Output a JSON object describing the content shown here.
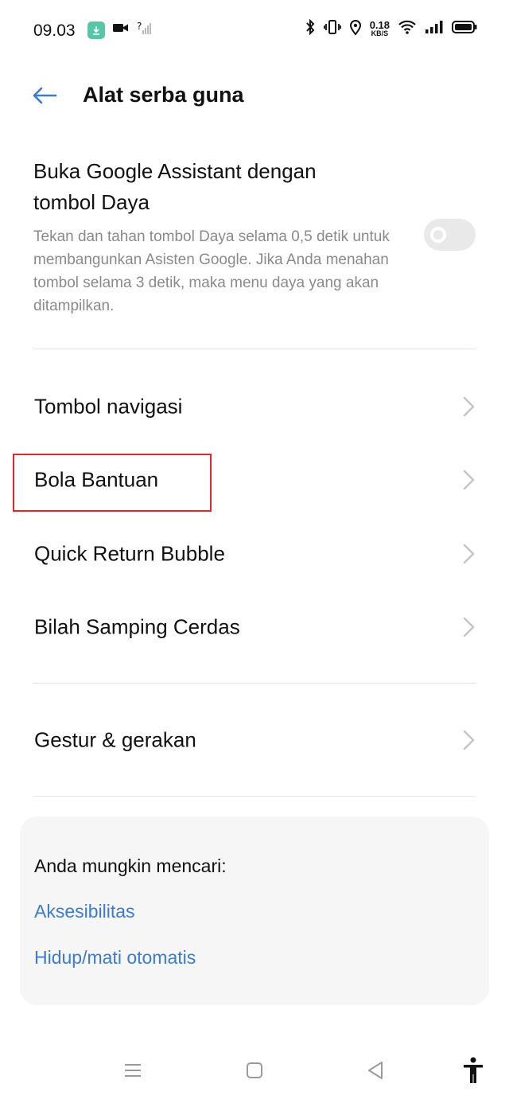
{
  "status_bar": {
    "time": "09.03",
    "net_speed_value": "0.18",
    "net_speed_unit": "KB/S"
  },
  "header": {
    "title": "Alat serba guna"
  },
  "google_assistant": {
    "title": "Buka Google Assistant dengan tombol Daya",
    "description": "Tekan dan tahan tombol Daya selama 0,5 detik untuk membangunkan Asisten Google. Jika Anda menahan tombol selama 3 detik, maka menu daya yang akan ditampilkan.",
    "enabled": false
  },
  "menu": {
    "items": [
      {
        "label": "Tombol navigasi"
      },
      {
        "label": "Bola Bantuan"
      },
      {
        "label": "Quick Return Bubble"
      },
      {
        "label": "Bilah Samping Cerdas"
      },
      {
        "label": "Gestur & gerakan"
      }
    ]
  },
  "suggestions": {
    "title": "Anda mungkin mencari:",
    "links": [
      {
        "label": "Aksesibilitas"
      },
      {
        "label": "Hidup/mati otomatis"
      }
    ]
  },
  "colors": {
    "accent": "#3b7bd1",
    "highlight": "#e3262a",
    "download_badge": "#57c6a6"
  }
}
